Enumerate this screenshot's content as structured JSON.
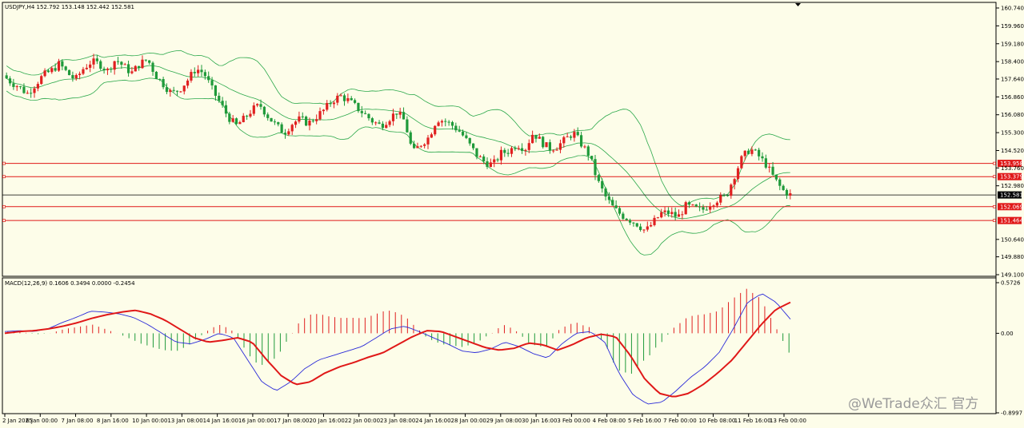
{
  "chart_data": [
    {
      "type": "candlestick",
      "title": "USDJPY,H4",
      "ohlc_readout": [
        "152.792",
        "153.148",
        "152.442",
        "152.581"
      ],
      "ylim": [
        149.1,
        160.74
      ],
      "y_ticks": [
        "160.740",
        "159.960",
        "159.180",
        "158.400",
        "157.640",
        "156.860",
        "156.080",
        "155.300",
        "154.520",
        "153.760",
        "152.980",
        "150.640",
        "149.880",
        "149.100"
      ],
      "x_ticks": [
        "2 Jan 2025",
        "6 Jan 00:00",
        "7 Jan 08:00",
        "8 Jan 16:00",
        "10 Jan 00:00",
        "13 Jan 08:00",
        "14 Jan 16:00",
        "16 Jan 00:00",
        "17 Jan 08:00",
        "20 Jan 16:00",
        "22 Jan 00:00",
        "23 Jan 08:00",
        "24 Jan 16:00",
        "28 Jan 00:00",
        "29 Jan 08:00",
        "30 Jan 16:00",
        "3 Feb 00:00",
        "4 Feb 08:00",
        "5 Feb 16:00",
        "7 Feb 00:00",
        "10 Feb 08:00",
        "11 Feb 16:00",
        "13 Feb 00:00"
      ],
      "current_price": {
        "label": "152.581",
        "value": 152.581
      },
      "horizontal_levels": [
        {
          "label": "153.958",
          "value": 153.958
        },
        {
          "label": "153.379",
          "value": 153.379
        },
        {
          "label": "152.069",
          "value": 152.069
        },
        {
          "label": "151.464",
          "value": 151.464
        }
      ],
      "close_path": [
        157.8,
        157.5,
        157.3,
        157.0,
        157.4,
        157.8,
        158.0,
        158.3,
        157.9,
        157.6,
        158.1,
        158.4,
        158.3,
        158.0,
        158.5,
        158.2,
        157.9,
        158.3,
        158.5,
        157.8,
        157.4,
        157.0,
        157.2,
        157.6,
        158.1,
        157.9,
        157.2,
        156.6,
        156.0,
        155.6,
        155.9,
        156.3,
        156.5,
        156.0,
        155.6,
        155.3,
        155.7,
        155.9,
        155.7,
        156.0,
        156.3,
        156.7,
        156.9,
        156.7,
        156.4,
        156.1,
        155.8,
        155.6,
        155.9,
        156.2,
        155.8,
        154.4,
        154.8,
        155.1,
        155.9,
        155.8,
        155.6,
        155.3,
        154.8,
        154.3,
        154.0,
        153.9,
        154.4,
        154.5,
        154.8,
        154.6,
        155.3,
        154.9,
        154.6,
        154.7,
        155.0,
        155.3,
        154.8,
        154.3,
        153.2,
        152.5,
        152.0,
        151.7,
        151.5,
        151.3,
        151.0,
        151.4,
        151.8,
        151.8,
        151.6,
        152.1,
        152.0,
        151.9,
        152.2,
        152.4,
        152.5,
        153.4,
        154.2,
        154.6,
        154.3,
        153.9,
        153.3,
        152.8,
        152.58
      ]
    },
    {
      "type": "macd",
      "title": "MACD(12,26,9)",
      "values_readout": [
        "0.1606",
        "0.3494",
        "0.0000",
        "-0.2454"
      ],
      "ylim": [
        -0.8997,
        0.5726
      ],
      "y_ticks": [
        "0.5726",
        "0.00",
        "-0.8997"
      ],
      "signal_path": [
        0.0,
        0.02,
        0.03,
        0.05,
        0.08,
        0.12,
        0.17,
        0.21,
        0.24,
        0.26,
        0.22,
        0.15,
        0.05,
        -0.05,
        -0.1,
        -0.08,
        -0.05,
        -0.1,
        -0.3,
        -0.48,
        -0.58,
        -0.55,
        -0.45,
        -0.38,
        -0.33,
        -0.27,
        -0.22,
        -0.13,
        -0.04,
        0.03,
        0.02,
        -0.04,
        -0.1,
        -0.16,
        -0.19,
        -0.17,
        -0.11,
        -0.13,
        -0.19,
        -0.13,
        -0.05,
        -0.01,
        -0.04,
        -0.25,
        -0.52,
        -0.68,
        -0.72,
        -0.68,
        -0.58,
        -0.45,
        -0.3,
        -0.1,
        0.1,
        0.27,
        0.35
      ],
      "macd_path": [
        0.02,
        0.03,
        0.02,
        0.05,
        0.12,
        0.18,
        0.25,
        0.24,
        0.22,
        0.18,
        0.1,
        0.0,
        -0.1,
        -0.12,
        -0.07,
        0.0,
        -0.05,
        -0.3,
        -0.55,
        -0.65,
        -0.55,
        -0.4,
        -0.3,
        -0.25,
        -0.2,
        -0.15,
        -0.05,
        0.05,
        0.08,
        0.02,
        -0.05,
        -0.12,
        -0.2,
        -0.22,
        -0.18,
        -0.1,
        -0.15,
        -0.23,
        -0.28,
        -0.12,
        0.0,
        0.02,
        -0.1,
        -0.45,
        -0.7,
        -0.8,
        -0.78,
        -0.65,
        -0.5,
        -0.38,
        -0.22,
        0.05,
        0.35,
        0.45,
        0.35,
        0.16
      ]
    }
  ],
  "watermark": "@WeTrade众汇 官方"
}
